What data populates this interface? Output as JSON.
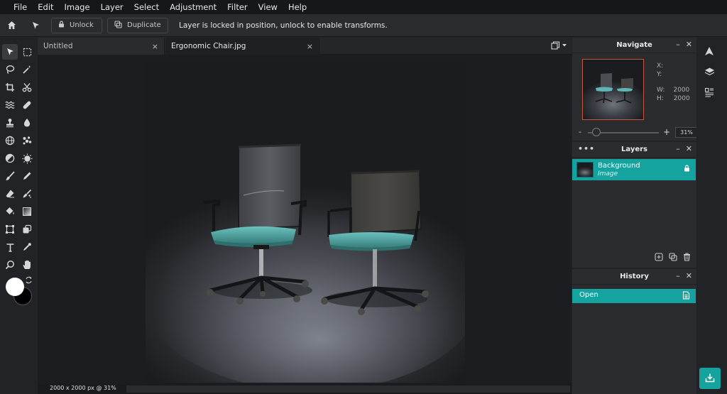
{
  "menubar": {
    "items": [
      "File",
      "Edit",
      "Image",
      "Layer",
      "Select",
      "Adjustment",
      "Filter",
      "View",
      "Help"
    ]
  },
  "optionsbar": {
    "unlock_label": "Unlock",
    "duplicate_label": "Duplicate",
    "message": "Layer is locked in position, unlock to enable transforms."
  },
  "tabs": [
    {
      "label": "Untitled",
      "close": "×"
    },
    {
      "label": "Ergonomic Chair.jpg",
      "close": "×"
    }
  ],
  "status": {
    "text": "2000 x 2000 px @ 31%"
  },
  "navigate": {
    "title": "Navigate",
    "x_label": "X:",
    "x_value": "",
    "y_label": "Y:",
    "y_value": "",
    "w_label": "W:",
    "w_value": "2000",
    "h_label": "H:",
    "h_value": "2000",
    "zoom_minus": "-",
    "zoom_plus": "+",
    "zoom_value": "31%"
  },
  "layers": {
    "title": "Layers",
    "items": [
      {
        "name": "Background",
        "type": "Image"
      }
    ]
  },
  "history": {
    "title": "History",
    "items": [
      {
        "label": "Open"
      }
    ]
  },
  "panel_controls": {
    "minimize": "–",
    "close": "✕",
    "more": "•••"
  },
  "colors": {
    "accent": "#15a39f",
    "foreground_swatch": "#ffffff",
    "background_swatch": "#000000",
    "seat": "#4fa8a6"
  },
  "icons": {
    "tools": [
      "move-icon",
      "marquee-icon",
      "lasso-icon",
      "magic-wand-icon",
      "crop-icon",
      "scissors-icon",
      "liquify-icon",
      "healing-icon",
      "stamp-icon",
      "drop-icon",
      "sphere-icon",
      "scatter-icon",
      "dodge-icon",
      "sponge-icon",
      "brush-icon",
      "pencil-icon",
      "eraser-icon",
      "smudge-icon",
      "fill-icon",
      "gradient-icon",
      "transform-icon",
      "shape-icon",
      "text-icon",
      "eyedropper-icon",
      "zoom-icon",
      "hand-icon"
    ]
  }
}
